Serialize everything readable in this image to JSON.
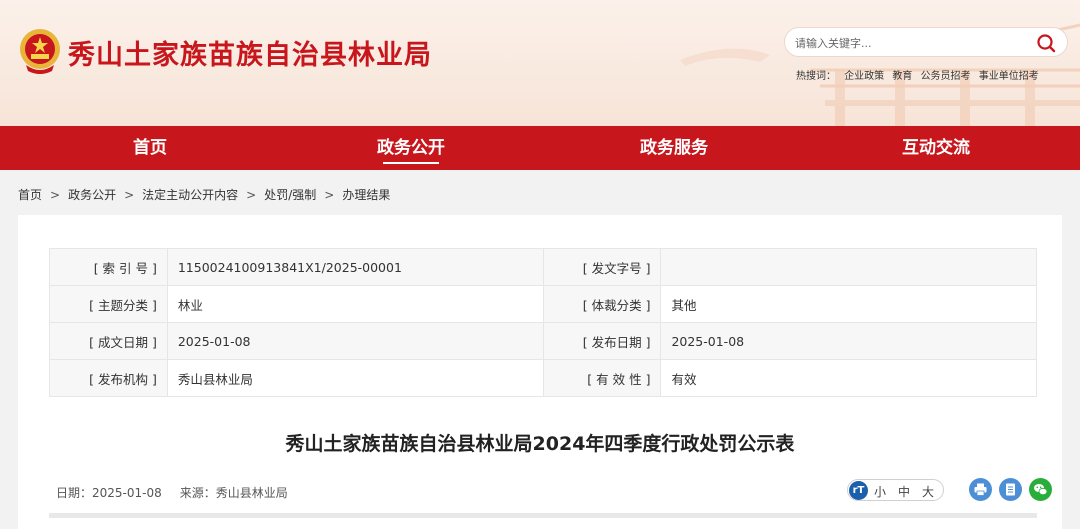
{
  "header": {
    "site_title": "秀山土家族苗族自治县林业局",
    "search_placeholder": "请输入关键字...",
    "hotwords_label": "热搜词：",
    "hotwords": [
      "企业政策",
      "教育",
      "公务员招考",
      "事业单位招考"
    ]
  },
  "nav": {
    "items": [
      {
        "label": "首页"
      },
      {
        "label": "政务公开"
      },
      {
        "label": "政务服务"
      },
      {
        "label": "互动交流"
      }
    ],
    "active_index": 1
  },
  "breadcrumb": [
    "首页",
    "政务公开",
    "法定主动公开内容",
    "处罚/强制",
    "办理结果"
  ],
  "meta": {
    "rows": [
      {
        "l1": "[ 索 引 号 ]",
        "v1": "1150024100913841X1/2025-00001",
        "l2": "[ 发文字号 ]",
        "v2": ""
      },
      {
        "l1": "[ 主题分类 ]",
        "v1": "林业",
        "l2": "[ 体裁分类 ]",
        "v2": "其他"
      },
      {
        "l1": "[ 成文日期 ]",
        "v1": "2025-01-08",
        "l2": "[ 发布日期 ]",
        "v2": "2025-01-08"
      },
      {
        "l1": "[ 发布机构 ]",
        "v1": "秀山县林业局",
        "l2": "[ 有 效 性 ]",
        "v2": "有效"
      }
    ]
  },
  "article": {
    "title": "秀山土家族苗族自治县林业局2024年四季度行政处罚公示表",
    "date": "日期：2025-01-08",
    "source": "来源：秀山县林业局"
  },
  "tools": {
    "fontsize_icon": "rT",
    "font_small": "小",
    "font_medium": "中",
    "font_large": "大"
  },
  "colors": {
    "brand_red": "#c8161d",
    "print_blue": "#4d8fd6",
    "wechat_green": "#2aae3b"
  }
}
